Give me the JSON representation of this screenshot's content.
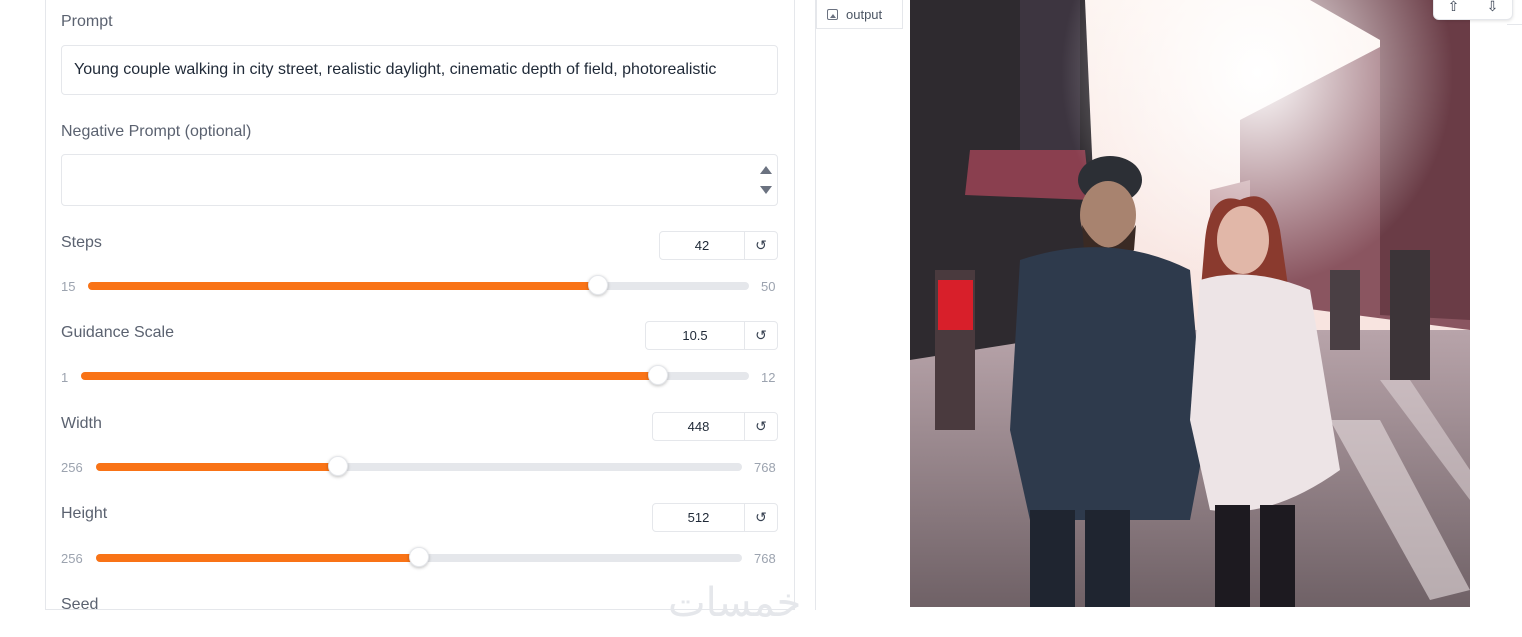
{
  "prompt": {
    "label": "Prompt",
    "value": "Young couple walking in city street, realistic daylight, cinematic depth of field, photorealistic"
  },
  "negative_prompt": {
    "label": "Negative Prompt (optional)",
    "value": ""
  },
  "sliders": {
    "steps": {
      "label": "Steps",
      "value": "42",
      "min": "15",
      "max": "50",
      "fraction": 0.771
    },
    "guidance": {
      "label": "Guidance Scale",
      "value": "10.5",
      "min": "1",
      "max": "12",
      "fraction": 0.864
    },
    "width": {
      "label": "Width",
      "value": "448",
      "min": "256",
      "max": "768",
      "fraction": 0.375
    },
    "height": {
      "label": "Height",
      "value": "512",
      "min": "256",
      "max": "768",
      "fraction": 0.5
    }
  },
  "seed": {
    "label": "Seed"
  },
  "output": {
    "tab_label": "output"
  },
  "icons": {
    "reset": "↺",
    "image": "image-icon",
    "share": "share-icon",
    "download": "download-icon"
  },
  "watermark": "خمسات",
  "colors": {
    "accent": "#f97316",
    "track": "#e5e7eb"
  }
}
